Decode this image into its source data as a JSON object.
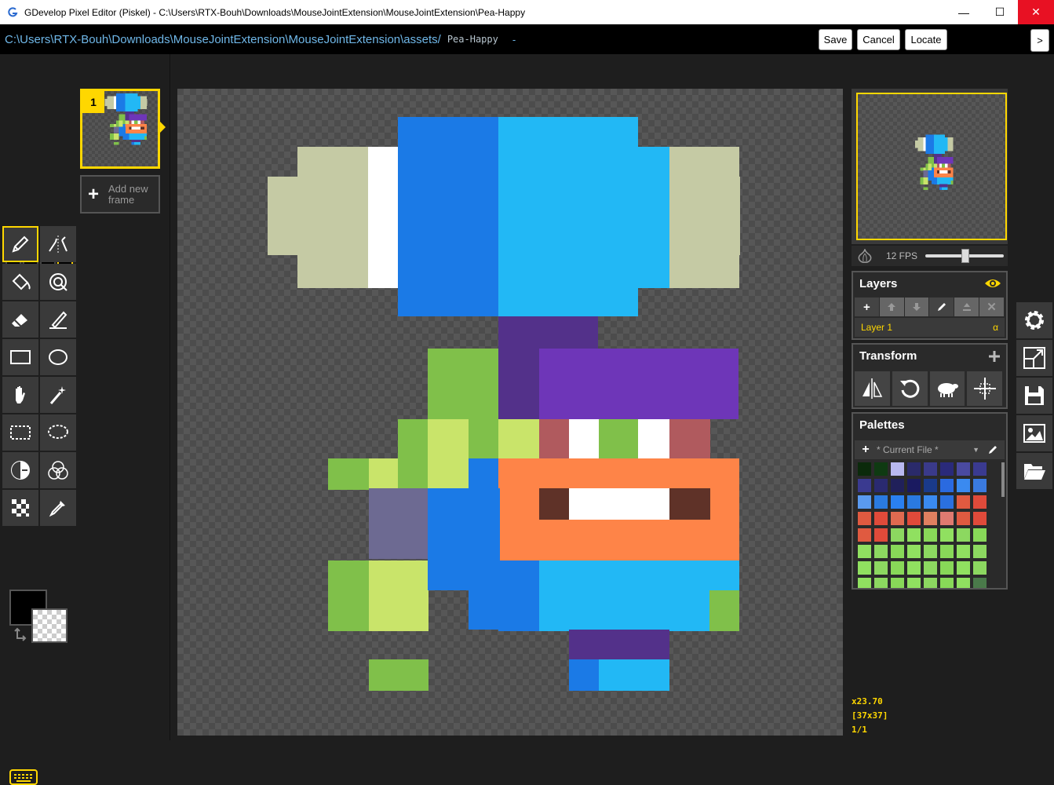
{
  "window": {
    "title": "GDevelop Pixel Editor (Piskel) - C:\\Users\\RTX-Bouh\\Downloads\\MouseJointExtension\\MouseJointExtension\\Pea-Happy",
    "minimize": "—",
    "maximize": "☐",
    "close": "✕"
  },
  "pathbar": {
    "path": "C:\\Users\\RTX-Bouh\\Downloads\\MouseJointExtension\\MouseJointExtension\\assets/",
    "name": "Pea-Happy",
    "dash": "-",
    "save": "Save",
    "cancel": "Cancel",
    "locate": "Locate",
    "more": ">"
  },
  "tools": {
    "pen_sizes": [
      "1",
      "2",
      "3",
      "4"
    ],
    "active_pen_size": 4,
    "items": [
      {
        "name": "pen-tool",
        "icon": "pencil-icon"
      },
      {
        "name": "vertical-mirror-pen-tool",
        "icon": "mirror-pen-icon"
      },
      {
        "name": "paint-bucket-tool",
        "icon": "bucket-icon"
      },
      {
        "name": "paint-same-color-tool",
        "icon": "same-color-icon"
      },
      {
        "name": "eraser-tool",
        "icon": "eraser-icon"
      },
      {
        "name": "stroke-tool",
        "icon": "stroke-icon"
      },
      {
        "name": "rectangle-tool",
        "icon": "rectangle-icon"
      },
      {
        "name": "circle-tool",
        "icon": "circle-icon"
      },
      {
        "name": "move-tool",
        "icon": "hand-icon"
      },
      {
        "name": "shape-selection-tool",
        "icon": "magic-wand-icon"
      },
      {
        "name": "rectangle-selection-tool",
        "icon": "rect-select-icon"
      },
      {
        "name": "lasso-selection-tool",
        "icon": "lasso-icon"
      },
      {
        "name": "lighten-tool",
        "icon": "lighten-icon"
      },
      {
        "name": "dithering-tool",
        "icon": "dither-icon"
      },
      {
        "name": "checker-tool",
        "icon": "checker-icon"
      },
      {
        "name": "color-picker-tool",
        "icon": "eyedropper-icon"
      }
    ],
    "primary_color": "#000000",
    "secondary_color": "transparent"
  },
  "frames": {
    "items": [
      {
        "number": "1"
      }
    ],
    "add_label_1": "Add new",
    "add_label_2": "frame"
  },
  "canvas": {
    "zoom": "x23.70",
    "size": "[37x37]",
    "frame": "1/1"
  },
  "preview": {
    "fps": "12 FPS",
    "fps_value": 12
  },
  "layers": {
    "title": "Layers",
    "items": [
      {
        "name": "Layer 1",
        "alpha": "α"
      }
    ]
  },
  "transform": {
    "title": "Transform"
  },
  "palettes": {
    "title": "Palettes",
    "selected": "* Current File *",
    "colors": [
      "#0b2a0b",
      "#0f3a12",
      "#b8b8f0",
      "#2a2a6a",
      "#3a3a8a",
      "#2a2a7a",
      "#4a4aa0",
      "#3a3a90",
      "#3a3a90",
      "#2a2a70",
      "#20205a",
      "#1a1a60",
      "#1a3a8a",
      "#2a6ae0",
      "#3a8af0",
      "#3a7ae0",
      "#5a9af0",
      "#2a7ae0",
      "#2a80f0",
      "#2a7ae0",
      "#3a8af0",
      "#2a70e0",
      "#e05a40",
      "#e04a3a",
      "#e05a40",
      "#e04a3a",
      "#e06a50",
      "#e04a3a",
      "#e08060",
      "#e07a70",
      "#e05a40",
      "#e04a3a",
      "#e05a40",
      "#e04a3a",
      "#8cd860",
      "#90e060",
      "#88d858",
      "#90e060",
      "#8cd860",
      "#88d858",
      "#90e060",
      "#8cd860",
      "#88d858",
      "#90e060",
      "#8cd860",
      "#88d858",
      "#90e060",
      "#8cd860",
      "#90e060",
      "#8cd860",
      "#88d858",
      "#90e060",
      "#8cd860",
      "#88d858",
      "#90e060",
      "#8cd860",
      "#90e060",
      "#8cd860",
      "#88d858",
      "#90e060",
      "#8cd860",
      "#88d858",
      "#90e060",
      "#4a7a4a"
    ]
  },
  "sprite_colors": {
    "blue_dark": "#1b7ae6",
    "blue_light": "#22b8f5",
    "sage": "#c5caa4",
    "white": "#ffffff",
    "purple_dark": "#53318a",
    "purple": "#6e36b8",
    "green": "#80c04a",
    "green_light": "#c9e46a",
    "gray_purple": "#6d6a92",
    "orange": "#fe8448",
    "red_brown": "#b05a5e",
    "brown": "#5f3228"
  }
}
